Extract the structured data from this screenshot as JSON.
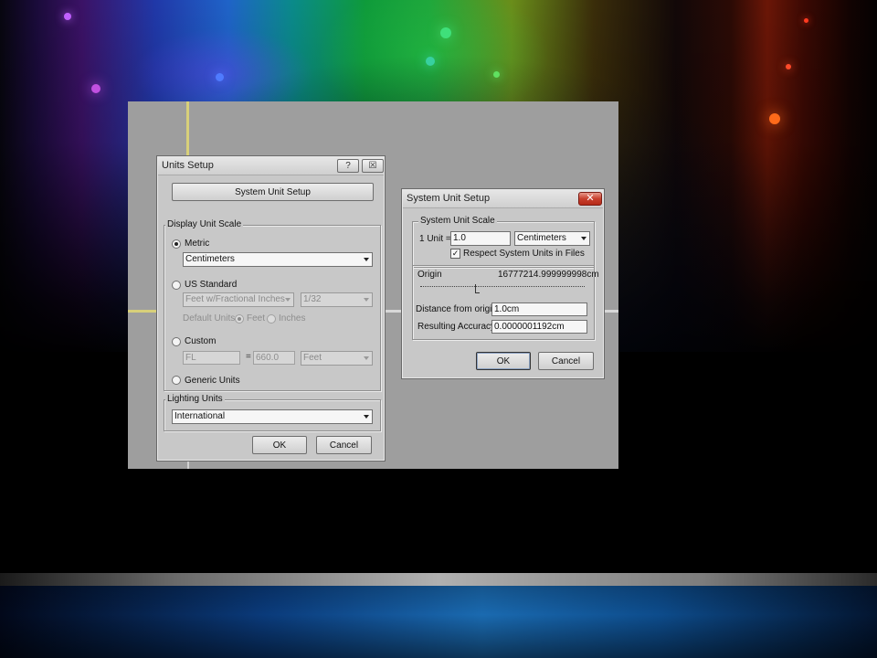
{
  "units_setup": {
    "title": "Units Setup",
    "help_label": "?",
    "close_label": "☒",
    "system_unit_setup_button": "System Unit Setup",
    "display_unit_scale": {
      "label": "Display Unit Scale",
      "metric_label": "Metric",
      "metric_checked": true,
      "metric_value": "Centimeters",
      "us_standard_label": "US Standard",
      "us_standard_value": "Feet w/Fractional Inches",
      "us_fraction_value": "1/32",
      "default_units_label": "Default Units:",
      "feet_label": "Feet",
      "inches_label": "Inches",
      "custom_label": "Custom",
      "custom_name": "FL",
      "equals": "=",
      "custom_value": "660.0",
      "custom_unit": "Feet",
      "generic_units_label": "Generic Units"
    },
    "lighting_units": {
      "label": "Lighting Units",
      "value": "International"
    },
    "ok_label": "OK",
    "cancel_label": "Cancel"
  },
  "system_unit_setup": {
    "title": "System Unit Setup",
    "close_label": "✕",
    "scale_group_label": "System Unit Scale",
    "unit_label": "1 Unit =",
    "unit_value": "1.0",
    "unit_type": "Centimeters",
    "respect_label": "Respect System Units in Files",
    "respect_checked": true,
    "origin_label": "Origin",
    "origin_value": "16777214.999999998cm",
    "distance_label": "Distance from origin:",
    "distance_value": "1.0cm",
    "accuracy_label": "Resulting Accuracy:",
    "accuracy_value": "0.0000001192cm",
    "ok_label": "OK",
    "cancel_label": "Cancel"
  }
}
